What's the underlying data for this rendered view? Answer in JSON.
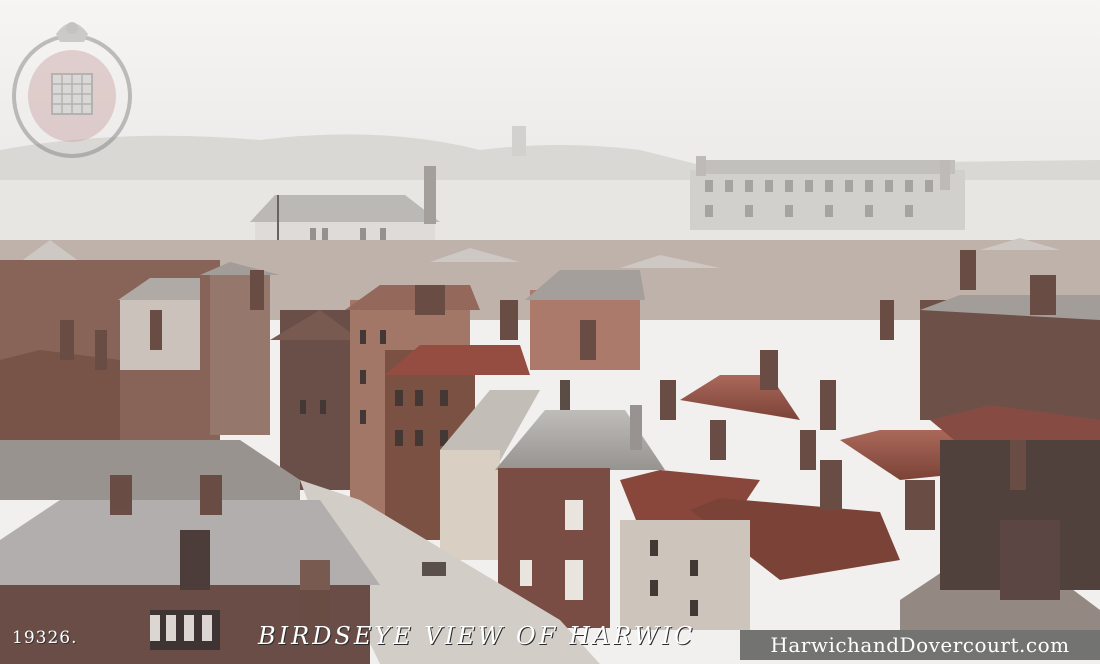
{
  "image": {
    "caption_code": "19326.",
    "caption_title": "BIRDSEYE VIEW OF HARWIC",
    "watermark": "HarwichandDovercourt.com",
    "colors": {
      "sky": "#f2f1ef",
      "haze": "#dcdcd8",
      "water": "#e8e8e6",
      "roof_red": "#8b3a2e",
      "roof_slate": "#8a8e90",
      "brick": "#7a4636",
      "shadow": "#3d2f2a"
    }
  }
}
